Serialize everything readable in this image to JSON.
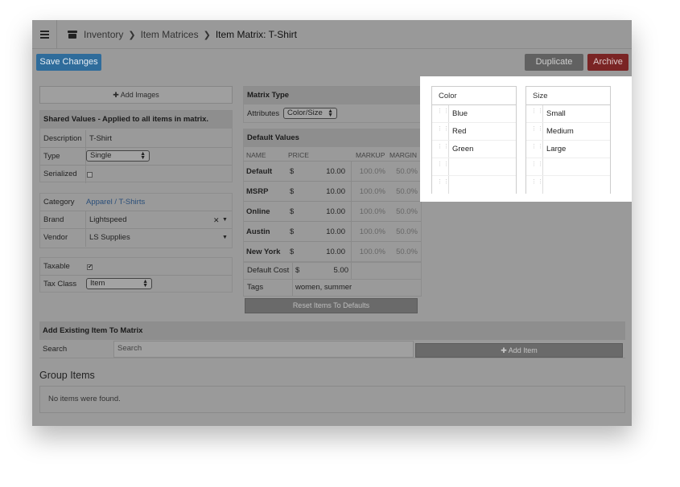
{
  "breadcrumb": {
    "items": [
      "Inventory",
      "Item Matrices"
    ],
    "current": "Item Matrix: T-Shirt"
  },
  "toolbar": {
    "save_label": "Save Changes",
    "duplicate_label": "Duplicate",
    "archive_label": "Archive"
  },
  "left": {
    "add_images_label": "Add Images",
    "shared_header": "Shared Values - Applied to all items in matrix.",
    "description_label": "Description",
    "description_value": "T-Shirt",
    "type_label": "Type",
    "type_value": "Single",
    "serialized_label": "Serialized",
    "category_label": "Category",
    "category_value": "Apparel / T-Shirts",
    "brand_label": "Brand",
    "brand_value": "Lightspeed",
    "vendor_label": "Vendor",
    "vendor_value": "LS Supplies",
    "taxable_label": "Taxable",
    "taxclass_label": "Tax Class",
    "taxclass_value": "Item"
  },
  "matrix": {
    "type_header": "Matrix Type",
    "attributes_label": "Attributes",
    "attributes_value": "Color/Size",
    "defaults_header": "Default Values",
    "columns": [
      "NAME",
      "PRICE",
      "MARKUP",
      "MARGIN"
    ],
    "currency": "$",
    "rows": [
      {
        "name": "Default",
        "price": "10.00",
        "markup": "100.0%",
        "margin": "50.0%"
      },
      {
        "name": "MSRP",
        "price": "10.00",
        "markup": "100.0%",
        "margin": "50.0%"
      },
      {
        "name": "Online",
        "price": "10.00",
        "markup": "100.0%",
        "margin": "50.0%"
      },
      {
        "name": "Austin",
        "price": "10.00",
        "markup": "100.0%",
        "margin": "50.0%"
      },
      {
        "name": "New York",
        "price": "10.00",
        "markup": "100.0%",
        "margin": "50.0%"
      }
    ],
    "default_cost_label": "Default Cost",
    "default_cost_value": "5.00",
    "tags_label": "Tags",
    "tags_value": "women, summer",
    "reset_label": "Reset Items To Defaults"
  },
  "attributes": {
    "color": {
      "header": "Color",
      "items": [
        "Blue",
        "Red",
        "Green",
        "",
        ""
      ]
    },
    "size": {
      "header": "Size",
      "items": [
        "Small",
        "Medium",
        "Large",
        "",
        ""
      ]
    }
  },
  "add_existing": {
    "header": "Add Existing Item To Matrix",
    "search_label": "Search",
    "search_placeholder": "Search",
    "add_item_label": "Add Item"
  },
  "group": {
    "title": "Group Items",
    "empty_text": "No items were found."
  }
}
